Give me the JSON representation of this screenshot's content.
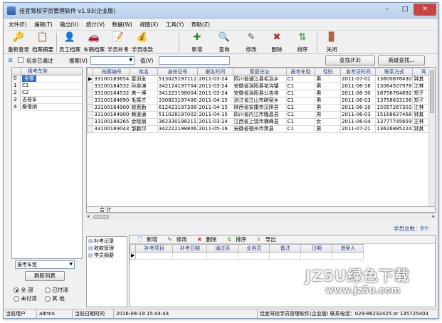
{
  "window": {
    "title": "佳宜驾校学员管理软件 v1.93(企业版)",
    "controls": {
      "min": "–",
      "max": "□",
      "close": "✕"
    }
  },
  "menu": [
    "文件(E)",
    "编辑(T)",
    "输出(U)",
    "统计(V)",
    "数据(W)",
    "视图(X)",
    "工具(Y)",
    "帮助(Z)"
  ],
  "toolbar": [
    {
      "label": "重新登录",
      "icon": "relogin-icon",
      "glyph": "🔑"
    },
    {
      "label": "档案摘要",
      "icon": "archive-summary-icon",
      "glyph": "📋"
    },
    {
      "label": "员工档案",
      "icon": "staff-record-icon",
      "glyph": "👤"
    },
    {
      "label": "车辆档案",
      "icon": "vehicle-record-icon",
      "glyph": "🚗"
    },
    {
      "label": "学员补考",
      "icon": "retest-icon",
      "glyph": "📝"
    },
    {
      "label": "学员收款",
      "icon": "payment-icon",
      "glyph": "💰"
    },
    {
      "label": "新增",
      "icon": "add-icon",
      "glyph": "✚"
    },
    {
      "label": "查询",
      "icon": "query-icon",
      "glyph": "🔍"
    },
    {
      "label": "修改",
      "icon": "edit-icon",
      "glyph": "✎"
    },
    {
      "label": "删除",
      "icon": "delete-icon",
      "glyph": "✖"
    },
    {
      "label": "排序",
      "icon": "sort-icon",
      "glyph": "⇅"
    },
    {
      "label": "关闭",
      "icon": "close-door-icon",
      "glyph": "🚪"
    }
  ],
  "search": {
    "include_passed": "包含已通过",
    "search_label": "搜索(V)",
    "value_label": "值(V)",
    "search_button": "查找(F3)",
    "advanced_button": "高级查找..."
  },
  "left_panel": {
    "header": "报考车型",
    "rows": [
      {
        "num": "0",
        "label": "全部"
      },
      {
        "num": "1",
        "label": "C1"
      },
      {
        "num": "2",
        "label": "C2"
      },
      {
        "num": "3",
        "label": "吉普车"
      },
      {
        "num": "4",
        "label": "桑塔纳"
      }
    ],
    "filter_select": "报考车型",
    "refresh_button": "刷新列表",
    "radios": [
      {
        "label": "全 部",
        "on": true
      },
      {
        "label": "已付清",
        "on": false
      },
      {
        "label": "未付清",
        "on": false
      },
      {
        "label": "其 他",
        "on": false
      }
    ]
  },
  "main_table": {
    "columns": [
      "档案编号",
      "姓名",
      "身份证号",
      "报名时间",
      "家庭住址",
      "报考车型",
      "性别",
      "准考证时间",
      "联系方式",
      "驾"
    ],
    "rows": [
      [
        "33100183654",
        "雷训全",
        "513025197111",
        "2011-03-24",
        "四川省通江县毛浴乡",
        "C1",
        "男",
        "2011-07-01",
        "13600876430",
        "钟其"
      ],
      [
        "33100184532",
        "孙自涛",
        "342124197704",
        "2011-03-24",
        "安徽省涡阳县花沟镇",
        "C1",
        "男",
        "2011-06-16",
        "13064507978",
        "江林"
      ],
      [
        "33100184532",
        "席一博",
        "341223198004",
        "2011-03-24",
        "安徽省涡阳县公吉寺",
        "C1",
        "男",
        "2011-06-30",
        "18756764892",
        "郑子"
      ],
      [
        "33100184890",
        "毛振才",
        "330823197406",
        "2011-04-15",
        "浙江省江山市碗窑乡",
        "C1",
        "男",
        "2011-06-03",
        "13758633156",
        "郑子"
      ],
      [
        "33100184900",
        "姚思勤",
        "612423197308",
        "2011-04-15",
        "陕西省安康市汉阴县",
        "C1",
        "男",
        "2011-06-10",
        "15057267303",
        "江林"
      ],
      [
        "33100184900",
        "赖道通",
        "511028197002",
        "2011-04-15",
        "四川省内江市隆昌县",
        "C1",
        "男",
        "2011-06-03",
        "15168637468",
        "钟其"
      ],
      [
        "33100188265",
        "余晓丽",
        "362330198211",
        "2011-03-24",
        "江西省上饶市横峰县",
        "C1",
        "女",
        "2011-06-04",
        "13777745659",
        "王林"
      ],
      [
        "33100189043",
        "邹鹏印",
        "342222198806",
        "2011-05-16",
        "安徽省宿州市萧县",
        "C1",
        "男",
        "2011-07-21",
        "13626885224",
        "钟其"
      ]
    ],
    "total_label": "合 计"
  },
  "student_total": "学员总数：8个",
  "nav_list": [
    "补考记录",
    "收款管理",
    "学员摘要"
  ],
  "detail_toolbar": [
    "新增",
    "修改",
    "删除",
    "排序",
    "导出"
  ],
  "detail_columns": [
    "补考项目",
    "补考日期",
    "通过否",
    "业务员",
    "备注",
    "日期",
    "港里人"
  ],
  "statusbar": {
    "user_label": "当前用户",
    "user": "admin",
    "date_label": "当前日期时间",
    "datetime": "2016-08-19 15:44:44",
    "info": "佳宜驾校学员管理软件(企业版)  联系电话：029-86232425 or 135725404"
  },
  "watermark": {
    "logo": "JZ5U绿色下载",
    "url": "www.jz5u.com"
  },
  "colors": {
    "selection": "#316ac5",
    "header_text": "#1f3f8f",
    "close_button": "#c7463f"
  }
}
